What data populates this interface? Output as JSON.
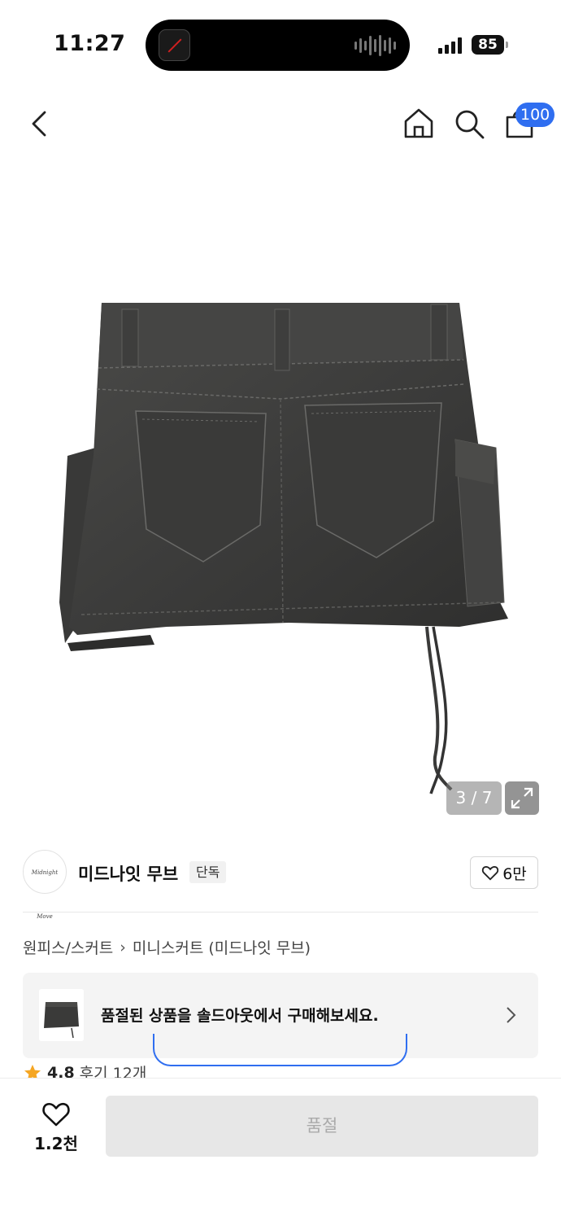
{
  "status_bar": {
    "time": "11:27",
    "battery": "85"
  },
  "header": {
    "back_icon": "chevron-left-icon",
    "home_icon": "home-icon",
    "search_icon": "search-icon",
    "cart_icon": "shopping-bag-icon",
    "cart_count": "100"
  },
  "gallery": {
    "page_indicator": "3 / 7",
    "expand_icon": "expand-icon"
  },
  "brand": {
    "name": "미드나잇 무브",
    "badge": "단독",
    "likes": "6만"
  },
  "breadcrumb": {
    "category": "원피스/스커트",
    "subcategory": "미니스커트 (미드나잇 무브)"
  },
  "soldout_banner": {
    "text": "품절된 상품을 솔드아웃에서 구매해보세요."
  },
  "rating": {
    "score": "4.8",
    "reviews": "후기 12개"
  },
  "bottom_bar": {
    "wish_count": "1.2천",
    "buy_label": "품절"
  },
  "colors": {
    "accent": "#2f6ef0",
    "rating_star": "#f5a623",
    "disabled_button": "#e7e7e7"
  }
}
